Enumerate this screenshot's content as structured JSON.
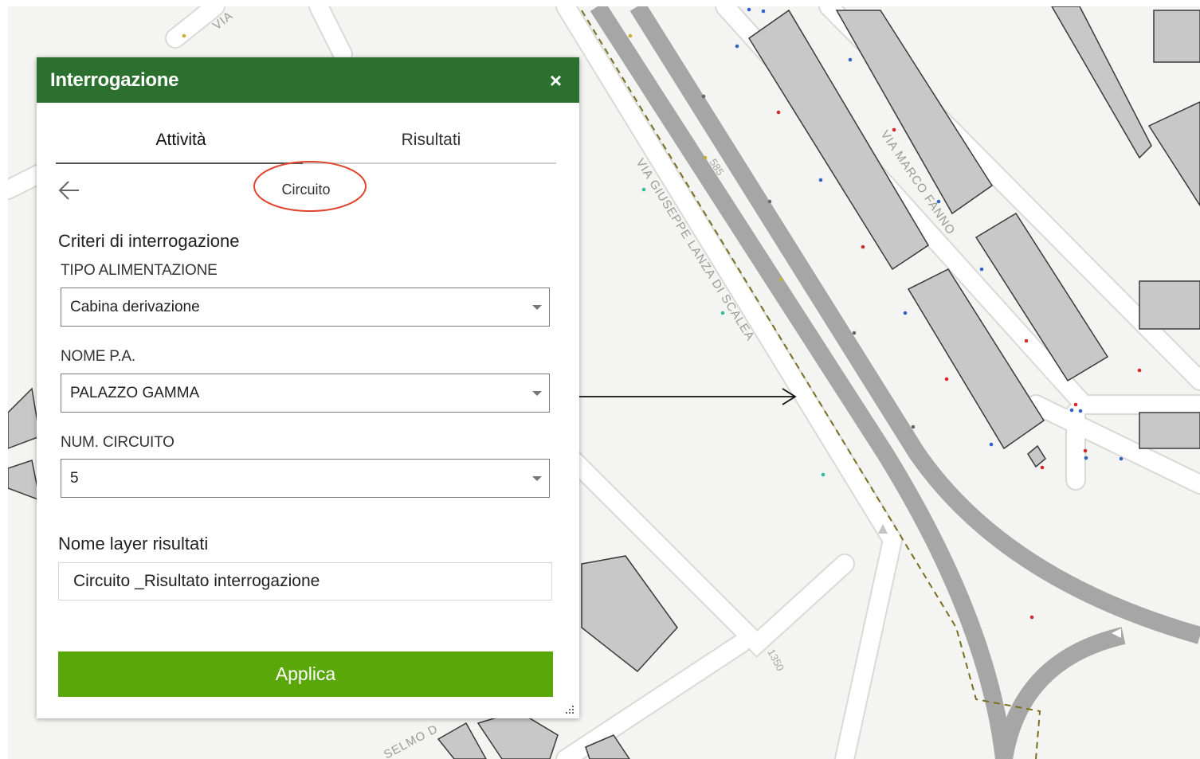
{
  "panel": {
    "title": "Interrogazione",
    "close_icon": "close-icon",
    "close_glyph": "×"
  },
  "tabs": [
    {
      "label": "Attività",
      "active": true
    },
    {
      "label": "Risultati",
      "active": false
    }
  ],
  "breadcrumb": {
    "back_icon": "arrow-left-icon",
    "current": "Circuito",
    "highlight_color": "#e0452f"
  },
  "criteria": {
    "title": "Criteri di interrogazione",
    "fields": [
      {
        "label": "TIPO ALIMENTAZIONE",
        "value": "Cabina derivazione"
      },
      {
        "label": "NOME P.A.",
        "value": "PALAZZO GAMMA"
      },
      {
        "label": "NUM. CIRCUITO",
        "value": "5"
      }
    ]
  },
  "result_layer": {
    "title": "Nome layer risultati",
    "value": "Circuito _Risultato interrogazione"
  },
  "apply_label": "Applica",
  "map": {
    "streets": [
      "VIA GIUSEPPE LANZA DI SCALEA",
      "VIA MARCO FANNO",
      "VIA",
      "SELMO D"
    ],
    "numbers": [
      "585",
      "1350"
    ]
  },
  "colors": {
    "header_green": "#2b702f",
    "apply_green": "#5aa70a",
    "map_background": "#f4f4f2",
    "building_gray": "#c8c8c8"
  }
}
